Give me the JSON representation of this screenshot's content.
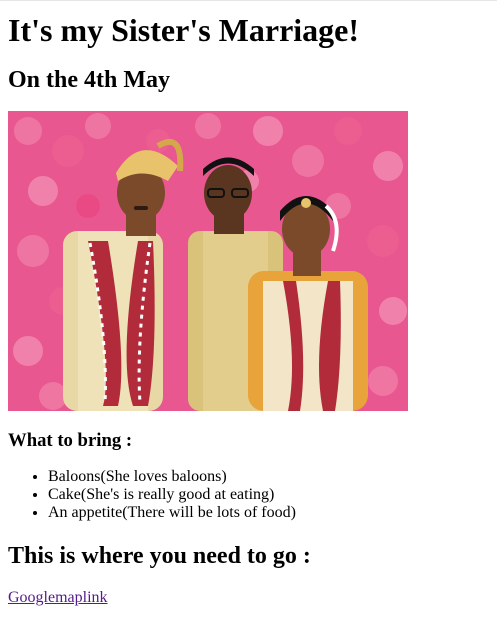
{
  "page": {
    "title": "It's my Sister's Marriage!",
    "date_heading": "On the 4th May",
    "bring_heading": "What to bring :",
    "bring_items": [
      "Baloons(She loves baloons)",
      "Cake(She's is really good at eating)",
      "An appetite(There will be lots of food)"
    ],
    "where_heading": "This is where you need to go :",
    "map_link_text": "Googlemaplink"
  },
  "photo": {
    "subject": "wedding-photo",
    "background_color": "#e8578f"
  },
  "colors": {
    "link_visited": "#551a8b",
    "text": "#000000"
  }
}
